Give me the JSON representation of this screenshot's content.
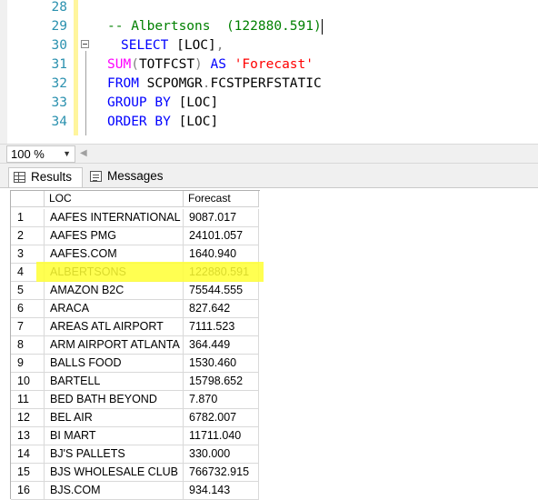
{
  "editor": {
    "line_numbers": [
      "28",
      "29",
      "30",
      "31",
      "32",
      "33",
      "34"
    ],
    "lines": [
      {
        "tokens": []
      },
      {
        "tokens": [
          {
            "t": "-- Albertsons  (122880.591)",
            "c": "cm"
          }
        ],
        "indent": "  ",
        "caret": true
      },
      {
        "tokens": [
          {
            "t": "SELECT",
            "c": "kw"
          },
          {
            "t": " [LOC]",
            "c": "pl"
          },
          {
            "t": ",",
            "c": "gr"
          }
        ],
        "indent": "    "
      },
      {
        "tokens": [
          {
            "t": "SUM",
            "c": "fn"
          },
          {
            "t": "(",
            "c": "gr"
          },
          {
            "t": "TOTFCST",
            "c": "pl"
          },
          {
            "t": ")",
            "c": "gr"
          },
          {
            "t": " AS ",
            "c": "kw"
          },
          {
            "t": "'Forecast'",
            "c": "str"
          }
        ],
        "indent": ""
      },
      {
        "tokens": [
          {
            "t": "FROM",
            "c": "kw"
          },
          {
            "t": " SCPOMGR",
            "c": "pl"
          },
          {
            "t": ".",
            "c": "gr"
          },
          {
            "t": "FCSTPERFSTATIC",
            "c": "pl"
          }
        ],
        "indent": ""
      },
      {
        "tokens": [
          {
            "t": "GROUP BY",
            "c": "kw"
          },
          {
            "t": " [LOC]",
            "c": "pl"
          }
        ],
        "indent": ""
      },
      {
        "tokens": [
          {
            "t": "ORDER BY",
            "c": "kw"
          },
          {
            "t": " [LOC]",
            "c": "pl"
          }
        ],
        "indent": ""
      }
    ]
  },
  "zoom": {
    "value": "100 %"
  },
  "tabs": {
    "results": "Results",
    "messages": "Messages"
  },
  "grid": {
    "headers": {
      "loc": "LOC",
      "forecast": "Forecast"
    },
    "highlight_color": "#ffff33",
    "highlighted_row": 4,
    "rows": [
      {
        "n": "1",
        "loc": "AAFES INTERNATIONAL",
        "val": "9087.017"
      },
      {
        "n": "2",
        "loc": "AAFES PMG",
        "val": "24101.057"
      },
      {
        "n": "3",
        "loc": "AAFES.COM",
        "val": "1640.940"
      },
      {
        "n": "4",
        "loc": "ALBERTSONS",
        "val": "122880.591"
      },
      {
        "n": "5",
        "loc": "AMAZON B2C",
        "val": "75544.555"
      },
      {
        "n": "6",
        "loc": "ARACA",
        "val": "827.642"
      },
      {
        "n": "7",
        "loc": "AREAS ATL AIRPORT",
        "val": "7111.523"
      },
      {
        "n": "8",
        "loc": "ARM AIRPORT ATLANTA",
        "val": "364.449"
      },
      {
        "n": "9",
        "loc": "BALLS FOOD",
        "val": "1530.460"
      },
      {
        "n": "10",
        "loc": "BARTELL",
        "val": "15798.652"
      },
      {
        "n": "11",
        "loc": "BED BATH BEYOND",
        "val": "7.870"
      },
      {
        "n": "12",
        "loc": "BEL AIR",
        "val": "6782.007"
      },
      {
        "n": "13",
        "loc": "BI MART",
        "val": "11711.040"
      },
      {
        "n": "14",
        "loc": "BJ'S PALLETS",
        "val": "330.000"
      },
      {
        "n": "15",
        "loc": "BJS WHOLESALE CLUB",
        "val": "766732.915"
      },
      {
        "n": "16",
        "loc": "BJS.COM",
        "val": "934.143"
      }
    ]
  }
}
